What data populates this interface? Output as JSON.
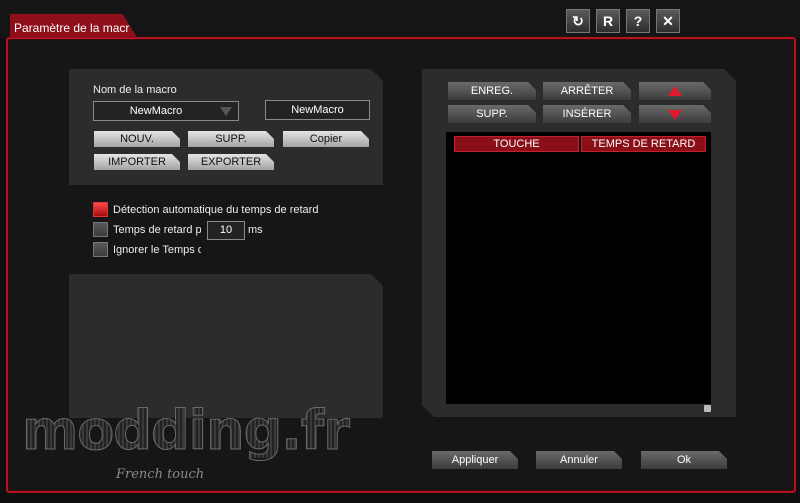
{
  "window": {
    "title": "Paramètre de la macr",
    "buttons": [
      {
        "name": "refresh-icon",
        "glyph": "↻"
      },
      {
        "name": "reset-icon",
        "glyph": "R"
      },
      {
        "name": "help-icon",
        "glyph": "?"
      },
      {
        "name": "close-icon",
        "glyph": "✕"
      }
    ]
  },
  "macro": {
    "name_label": "Nom de la macro",
    "dropdown_value": "NewMacro",
    "name_field_value": "NewMacro",
    "buttons": {
      "new": "NOUV.",
      "delete": "SUPP.",
      "copy": "Copier",
      "import": "IMPORTER",
      "export": "EXPORTER"
    }
  },
  "options": {
    "auto_delay": {
      "label": "Détection automatique du temps de retard",
      "checked": true
    },
    "fixed_delay": {
      "label": "Temps de retard pa",
      "value": "10",
      "unit": "ms",
      "checked": false
    },
    "ignore_delay": {
      "label": "Ignorer le Temps d",
      "checked": false
    }
  },
  "recorder": {
    "record": "ENREG.",
    "stop": "ARRÊTER",
    "delete": "SUPP.",
    "insert": "INSÉRER",
    "columns": [
      "TOUCHE",
      "TEMPS DE RETARD"
    ]
  },
  "footer": {
    "apply": "Appliquer",
    "cancel": "Annuler",
    "ok": "Ok"
  },
  "watermark": {
    "brand": "modding.fr",
    "tagline": "French touch"
  },
  "colors": {
    "accent": "#b3121f",
    "panel": "#2c2c2c",
    "arrow": "#e0192b"
  }
}
